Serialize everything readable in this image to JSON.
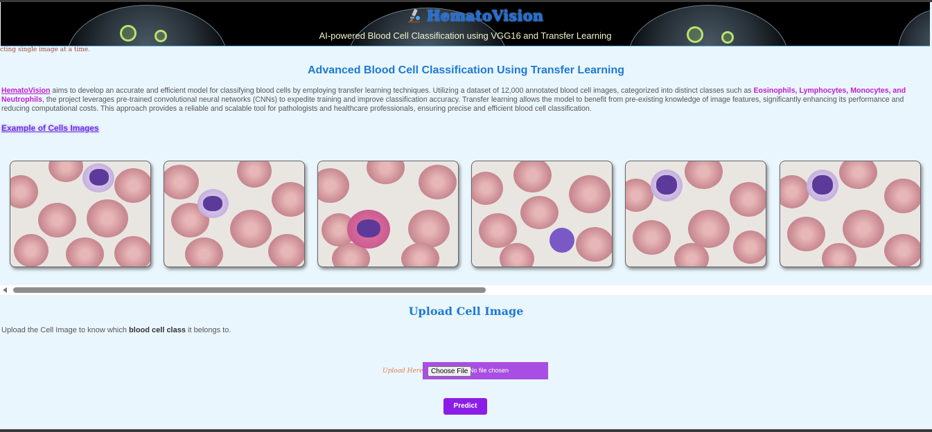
{
  "header": {
    "brand": "HematoVision",
    "tagline": "AI-powered Blood Cell Classification using VGG16 and Transfer Learning",
    "logo_icon": "microscope-icon"
  },
  "marquee_text": "cting single image at a time.",
  "section_title": "Advanced Blood Cell Classification Using Transfer Learning",
  "intro": {
    "brand_link": "HematoVision",
    "text_1": " aims to develop an accurate and efficient model for classifying blood cells by employing transfer learning techniques. Utilizing a dataset of 12,000 annotated blood cell images, categorized into distinct classes such as ",
    "classes": "Eosinophils, Lymphocytes, Monocytes, and Neutrophils",
    "text_2": ", the project leverages pre-trained convolutional neural networks (CNNs) to expedite training and improve classification accuracy. Transfer learning allows the model to benefit from pre-existing knowledge of image features, significantly enhancing its performance and reducing computational costs. This approach provides a reliable and scalable tool for pathologists and healthcare professionals, ensuring precise and efficient blood cell classification."
  },
  "example_link": "Example of Cells Images",
  "gallery": {
    "images": [
      "cell-image-1",
      "cell-image-2",
      "cell-image-3",
      "cell-image-4",
      "cell-image-5",
      "cell-image-6"
    ]
  },
  "upload": {
    "title": "Upload Cell Image",
    "desc_1": "Upload the Cell Image to know which ",
    "desc_bold": "blood cell class",
    "desc_2": " it belongs to.",
    "label": "Upload Here:",
    "choose_button": "Choose File",
    "file_status": "No file chosen",
    "predict_button": "Predict"
  },
  "colors": {
    "accent": "#1b7ad6",
    "brand_pink": "#c01fcf",
    "button_purple": "#8b1ee6",
    "page_bg": "#eaf6fd"
  }
}
